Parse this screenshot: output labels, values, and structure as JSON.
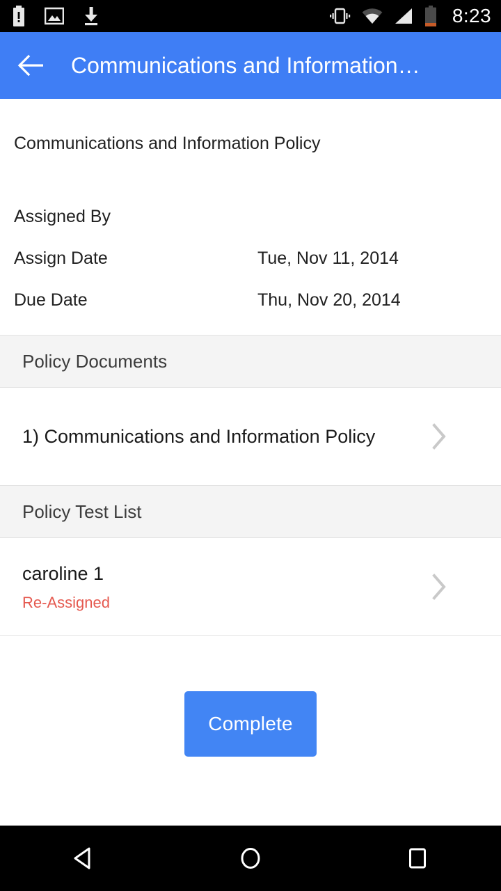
{
  "status_bar": {
    "left_icons": [
      "battery-alert-icon",
      "photo-icon",
      "download-icon"
    ],
    "right_icons": [
      "vibrate-icon",
      "wifi-icon",
      "signal-icon",
      "battery-icon"
    ],
    "time": "8:23"
  },
  "app_bar": {
    "back_icon": "back-arrow-icon",
    "title": "Communications and Information…",
    "background_color": "#3f7ef5"
  },
  "main": {
    "policy_title": "Communications and Information Policy",
    "details": [
      {
        "label": "Assigned By",
        "value": ""
      },
      {
        "label": "Assign Date",
        "value": "Tue, Nov 11, 2014"
      },
      {
        "label": "Due Date",
        "value": "Thu, Nov 20, 2014"
      }
    ],
    "documents_section": {
      "header": "Policy Documents",
      "items": [
        {
          "title": "1) Communications and Information Policy",
          "chevron": "chevron-right-icon"
        }
      ]
    },
    "test_section": {
      "header": "Policy Test List",
      "items": [
        {
          "title": "caroline 1",
          "status": "Re-Assigned",
          "status_color": "#e5594f",
          "chevron": "chevron-right-icon"
        }
      ]
    },
    "complete_button": {
      "label": "Complete",
      "color": "#4285f4"
    }
  },
  "nav_bar": {
    "back_label": "back-triangle-icon",
    "home_label": "home-circle-icon",
    "recents_label": "recents-square-icon"
  }
}
